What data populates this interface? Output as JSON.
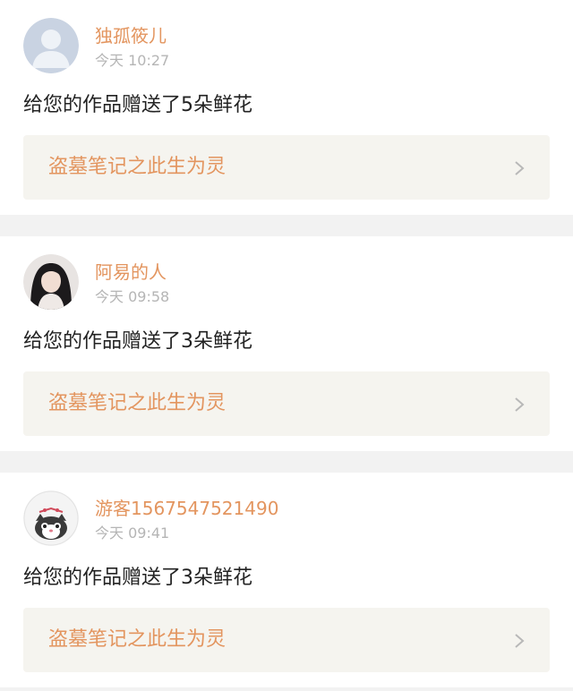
{
  "notifications": [
    {
      "username": "独孤筱儿",
      "time": "今天 10:27",
      "message": "给您的作品赠送了5朵鲜花",
      "work_title": "盗墓笔记之此生为灵",
      "avatar": "default-user-icon"
    },
    {
      "username": "阿易的人",
      "time": "今天 09:58",
      "message": "给您的作品赠送了3朵鲜花",
      "work_title": "盗墓笔记之此生为灵",
      "avatar": "photo-avatar"
    },
    {
      "username": "游客1567547521490",
      "time": "今天 09:41",
      "message": "给您的作品赠送了3朵鲜花",
      "work_title": "盗墓笔记之此生为灵",
      "avatar": "cat-avatar"
    }
  ],
  "colors": {
    "accent": "#e3955f",
    "timestamp": "#b5b5b5",
    "message": "#222222",
    "link_background": "#f5f4ef",
    "separator": "#f2f2f2"
  }
}
